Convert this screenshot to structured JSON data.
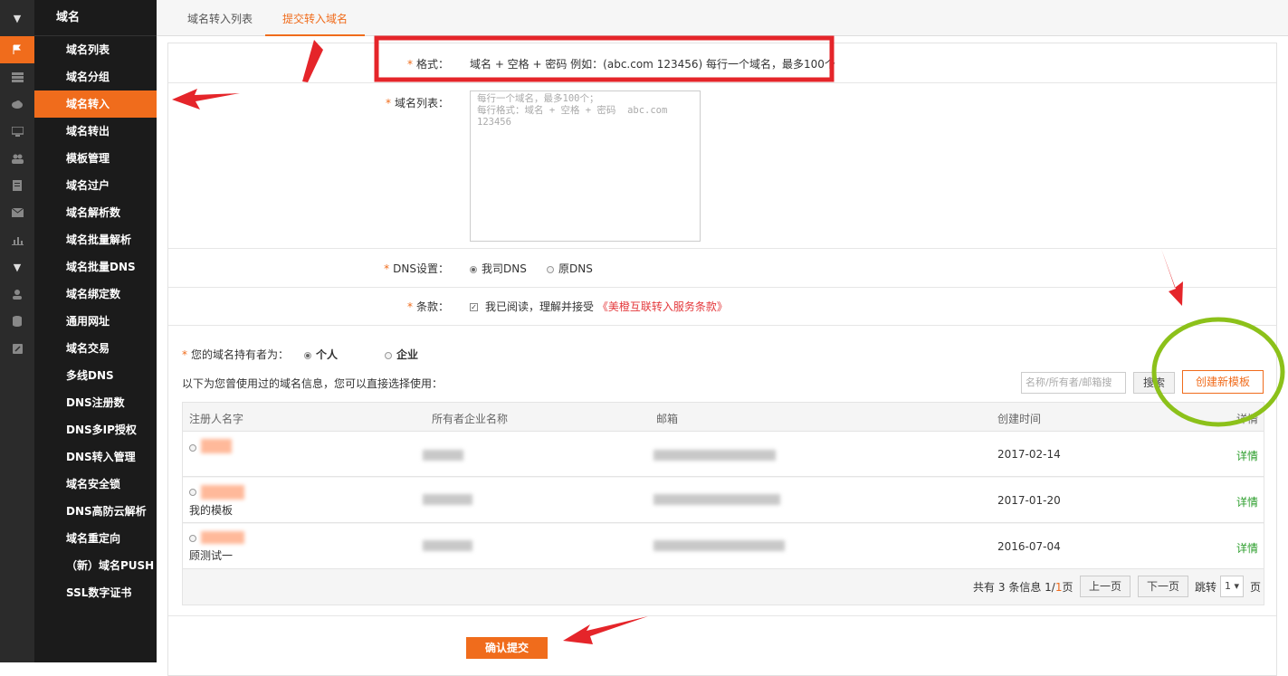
{
  "sidebar": {
    "header": "域名",
    "items": [
      "域名列表",
      "域名分组",
      "域名转入",
      "域名转出",
      "模板管理",
      "域名过户",
      "域名解析数",
      "域名批量解析",
      "域名批量DNS",
      "域名绑定数",
      "通用网址",
      "域名交易",
      "多线DNS",
      "DNS注册数",
      "DNS多IP授权",
      "DNS转入管理",
      "域名安全锁",
      "DNS高防云解析",
      "域名重定向",
      "（新）域名PUSH",
      "SSL数字证书"
    ],
    "active_index": 2
  },
  "icons": [
    "flag-icon",
    "server-icon",
    "cloud-icon",
    "monitor-icon",
    "users-icon",
    "document-icon",
    "mail-icon",
    "chart-icon",
    "caret-down-icon",
    "user-icon",
    "database-icon",
    "edit-icon"
  ],
  "tabs": [
    "域名转入列表",
    "提交转入域名"
  ],
  "form": {
    "req": "*",
    "format_label": "格式：",
    "format_value": "域名 + 空格 + 密码 例如：(abc.com 123456) 每行一个域名，最多100个",
    "list_label": "域名列表：",
    "list_placeholder": "每行一个域名，最多100个；\n每行格式：域名 + 空格 + 密码  abc.com\n123456",
    "dns_label": "DNS设置：",
    "dns_options": [
      "我司DNS",
      "原DNS"
    ],
    "terms_label": "条款：",
    "terms_text": "我已阅读，理解并接受",
    "terms_link": "《美橙互联转入服务条款》"
  },
  "holder": {
    "label": "您的域名持有者为：",
    "options": [
      "个人",
      "企业"
    ],
    "hint": "以下为您曾使用过的域名信息，您可以直接选择使用：",
    "search_placeholder": "名称/所有者/邮箱搜",
    "search_button": "搜索",
    "create_button": "创建新模板"
  },
  "table": {
    "headers": [
      "注册人名字",
      "所有者企业名称",
      "邮箱",
      "创建时间",
      "详情"
    ],
    "rows": [
      {
        "name": "",
        "created": "2017-02-14",
        "detail": "详情"
      },
      {
        "name": "我的模板",
        "created": "2017-01-20",
        "detail": "详情"
      },
      {
        "name": "顾测试一",
        "created": "2016-07-04",
        "detail": "详情"
      }
    ]
  },
  "pager": {
    "prefix": "共有",
    "count": "3",
    "mid": "条信息",
    "page": "1/",
    "total": "1",
    "suffix": "页",
    "prev": "上一页",
    "next": "下一页",
    "jump": "跳转",
    "current": "1",
    "page_unit": "页"
  },
  "submit": "确认提交",
  "colors": {
    "accent": "#f06c1c",
    "annotation_red": "#e5252a",
    "annotation_green": "#8cc11a"
  }
}
